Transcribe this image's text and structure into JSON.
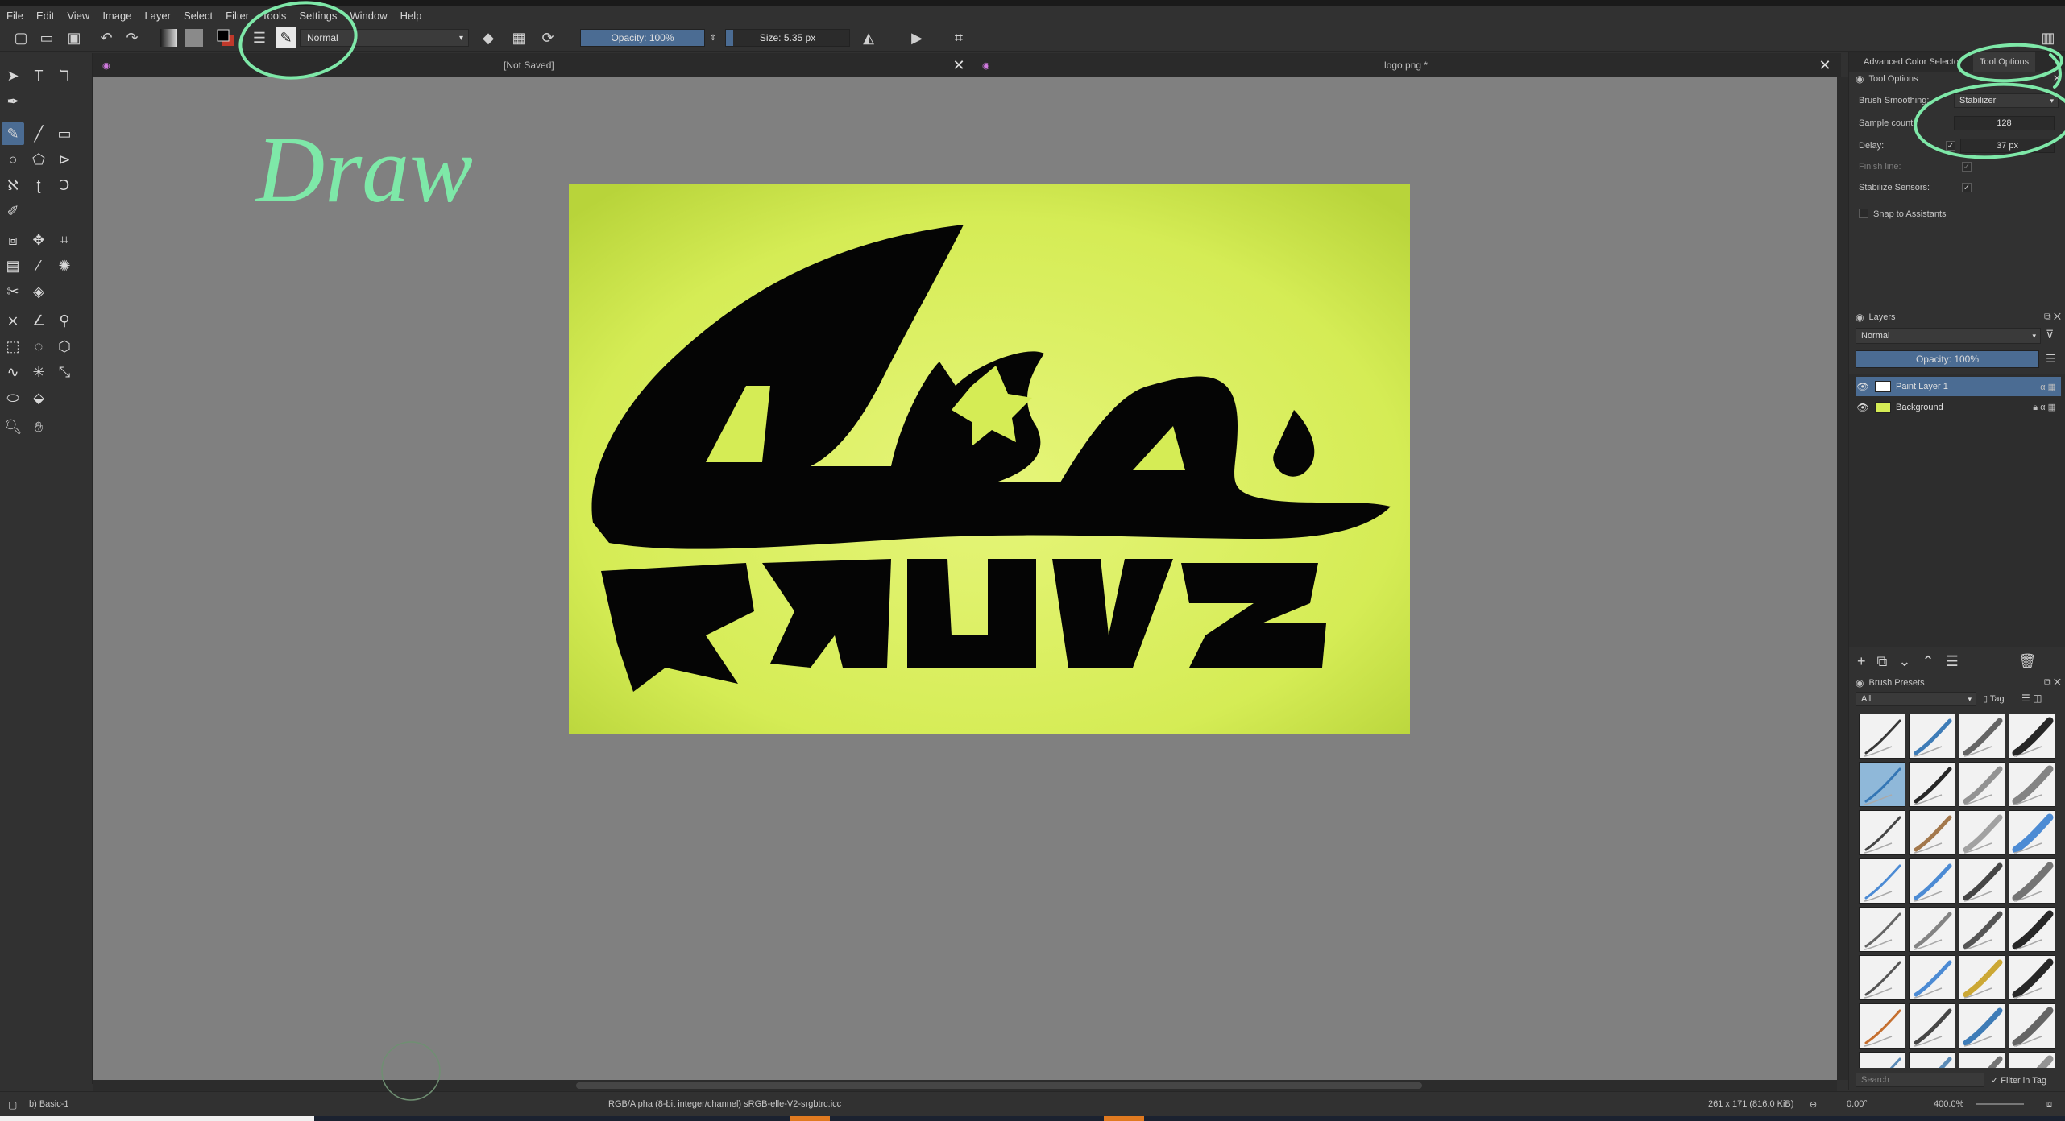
{
  "menu": [
    "File",
    "Edit",
    "View",
    "Image",
    "Layer",
    "Select",
    "Filter",
    "Tools",
    "Settings",
    "Window",
    "Help"
  ],
  "toolbar": {
    "blend_mode": "Normal",
    "opacity": "Opacity: 100%",
    "opacity_level": 1.0,
    "size": "Size: 5.35 px",
    "size_level": 0.06
  },
  "tabs": {
    "left": "[Not Saved]",
    "right": "logo.png *"
  },
  "annotation": {
    "draw_text": "Draw"
  },
  "dock": {
    "tab_color": "Advanced Color Selector",
    "tab_tool": "Tool Options",
    "tool_options_title": "Tool Options",
    "brush_smoothing_label": "Brush Smoothing:",
    "brush_smoothing_value": "Stabilizer",
    "sample_count_label": "Sample count:",
    "sample_count_value": "128",
    "delay_label": "Delay:",
    "delay_value": "37 px",
    "finish_line_label": "Finish line:",
    "stabilize_sensors_label": "Stabilize Sensors:",
    "snap_label": "Snap to Assistants",
    "layers_title": "Layers",
    "layers_blend": "Normal",
    "layers_opacity": "Opacity: 100%",
    "layers": [
      {
        "name": "Paint Layer 1",
        "selected": true
      },
      {
        "name": "Background",
        "selected": false
      }
    ],
    "presets_title": "Brush Presets",
    "presets_filter": "All",
    "presets_tag": "Tag",
    "search_placeholder": "Search",
    "filter_in_tag": "Filter in Tag"
  },
  "status": {
    "brush": "b) Basic-1",
    "color_space": "RGB/Alpha (8-bit integer/channel)  sRGB-elle-V2-srgbtrc.icc",
    "dimensions": "261 x 171 (816.0 KiB)",
    "rotation": "0.00°",
    "zoom": "400.0%"
  },
  "colors": {
    "accent": "#4b6c93",
    "annotation": "#7ee8a8",
    "doc_bg": "#d8ef5a"
  }
}
